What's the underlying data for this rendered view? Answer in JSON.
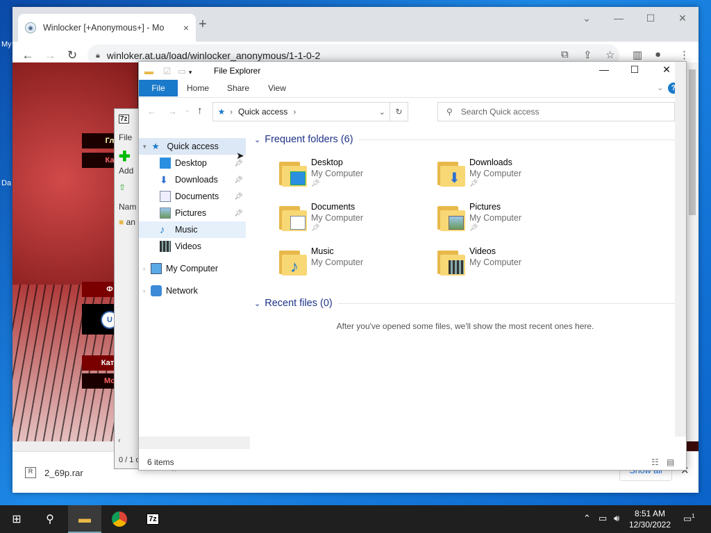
{
  "desktop": {
    "labels": [
      "My",
      "Da"
    ]
  },
  "browser": {
    "tab_title": "Winlocker [+Anonymous+] - Мо",
    "tab_close": "×",
    "new_tab": "+",
    "controls": {
      "chevron": "⌄",
      "minimize": "—",
      "maximize": "☐",
      "close": "✕"
    },
    "nav": {
      "back": "←",
      "forward": "→",
      "reload": "↻"
    },
    "url": "winloker.at.ua/load/winlocker_anonymous/1-1-0-2",
    "page_menu": [
      "Гл",
      "Ка",
      "Ф",
      "Кате",
      "Мо"
    ],
    "page_badge": "U",
    "download": {
      "file": "2_69p.rar",
      "show_all": "Show all",
      "close": "✕"
    }
  },
  "sevenzip": {
    "title_icon": "7z",
    "labels": [
      "File",
      "Add",
      "Nam",
      "an",
      "0 / 1 o"
    ]
  },
  "explorer": {
    "title": "File Explorer",
    "controls": {
      "minimize": "—",
      "maximize": "☐",
      "close": "✕"
    },
    "ribbon_tabs": [
      "File",
      "Home",
      "Share",
      "View"
    ],
    "help": "?",
    "address": {
      "root_icon": "star-pin-icon",
      "crumb": "Quick access"
    },
    "search_placeholder": "Search Quick access",
    "nav": {
      "quick_access": "Quick access",
      "items": [
        {
          "label": "Desktop",
          "pinned": true
        },
        {
          "label": "Downloads",
          "pinned": true
        },
        {
          "label": "Documents",
          "pinned": true
        },
        {
          "label": "Pictures",
          "pinned": true
        },
        {
          "label": "Music",
          "pinned": false
        },
        {
          "label": "Videos",
          "pinned": false
        }
      ],
      "my_computer": "My Computer",
      "network": "Network"
    },
    "frequent_header": "Frequent folders (6)",
    "folders": [
      {
        "name": "Desktop",
        "location": "My Computer",
        "pinned": true
      },
      {
        "name": "Downloads",
        "location": "My Computer",
        "pinned": true
      },
      {
        "name": "Documents",
        "location": "My Computer",
        "pinned": true
      },
      {
        "name": "Pictures",
        "location": "My Computer",
        "pinned": true
      },
      {
        "name": "Music",
        "location": "My Computer",
        "pinned": false
      },
      {
        "name": "Videos",
        "location": "My Computer",
        "pinned": false
      }
    ],
    "recent_header": "Recent files (0)",
    "recent_empty": "After you've opened some files, we'll show the most recent ones here.",
    "status": "6 items"
  },
  "taskbar": {
    "time": "8:51 AM",
    "date": "12/30/2022",
    "notification_count": "1",
    "sevenzip_label": "7z"
  },
  "colors": {
    "accent": "#1979ca",
    "section_header": "#1e3287",
    "taskbar": "#1f1f1f"
  }
}
